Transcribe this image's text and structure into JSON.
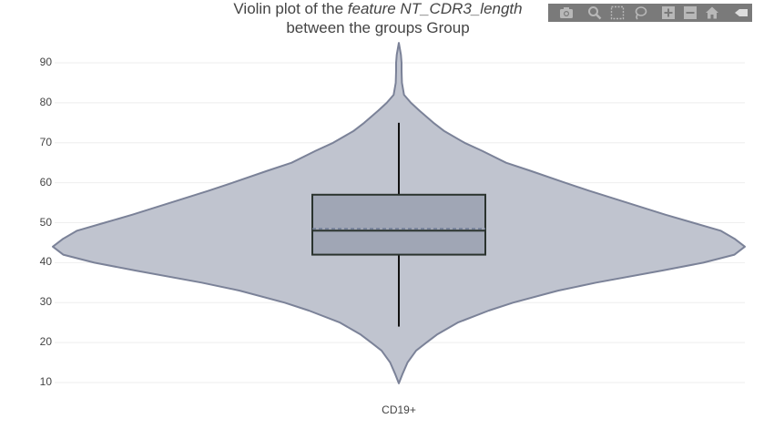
{
  "title": {
    "prefix": "Violin plot of the ",
    "italic": "feature NT_CDR3_length",
    "line2": "between the groups Group"
  },
  "modebar": {
    "buttons": [
      "camera-icon",
      "zoom-icon",
      "box-select-icon",
      "lasso-icon",
      "zoom-in-icon",
      "zoom-out-icon",
      "home-icon",
      "collapse-icon"
    ]
  },
  "chart_data": {
    "type": "violin",
    "categories": [
      "CD19+"
    ],
    "yticks": [
      10,
      20,
      30,
      40,
      50,
      60,
      70,
      80,
      90
    ],
    "ylim": [
      8,
      97
    ],
    "grid": true,
    "legend": "none",
    "series": [
      {
        "category": "CD19+",
        "box": {
          "min": 24,
          "q1": 42,
          "median": 48,
          "q3": 57,
          "max": 75,
          "mean": 48.5
        },
        "kde_range": [
          9.8,
          95
        ],
        "density": [
          [
            9.8,
            0.0
          ],
          [
            12,
            0.01
          ],
          [
            15,
            0.025
          ],
          [
            18,
            0.05
          ],
          [
            20,
            0.08
          ],
          [
            22,
            0.11
          ],
          [
            25,
            0.17
          ],
          [
            28,
            0.26
          ],
          [
            30,
            0.33
          ],
          [
            33,
            0.46
          ],
          [
            35,
            0.57
          ],
          [
            38,
            0.76
          ],
          [
            40,
            0.88
          ],
          [
            42,
            0.97
          ],
          [
            44,
            1.0
          ],
          [
            46,
            0.97
          ],
          [
            48,
            0.93
          ],
          [
            50,
            0.85
          ],
          [
            52,
            0.77
          ],
          [
            55,
            0.66
          ],
          [
            58,
            0.55
          ],
          [
            60,
            0.48
          ],
          [
            63,
            0.38
          ],
          [
            65,
            0.31
          ],
          [
            68,
            0.24
          ],
          [
            70,
            0.19
          ],
          [
            73,
            0.13
          ],
          [
            75,
            0.1
          ],
          [
            78,
            0.06
          ],
          [
            80,
            0.035
          ],
          [
            82,
            0.015
          ],
          [
            85,
            0.009
          ],
          [
            88,
            0.008
          ],
          [
            90,
            0.008
          ],
          [
            92,
            0.006
          ],
          [
            95,
            0.0
          ]
        ]
      }
    ],
    "colors": {
      "fill": "#c0c4cf",
      "outline": "#7b8298",
      "box_fill": "#a0a6b5",
      "box_stroke": "#2a332e",
      "grid": "#eeeeee",
      "mean_line": "#6d7a93"
    }
  }
}
